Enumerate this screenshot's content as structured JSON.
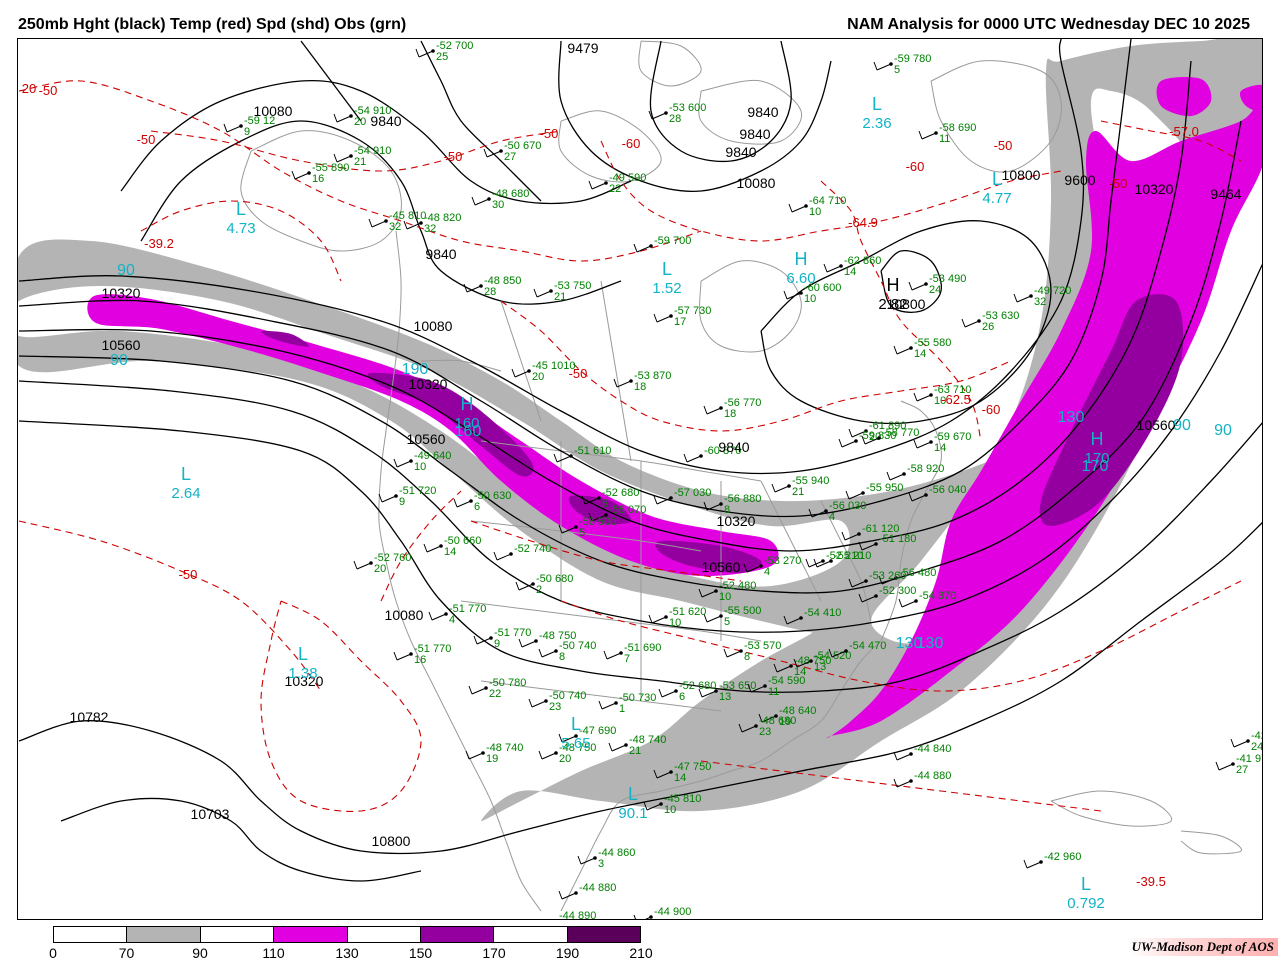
{
  "header": {
    "left_title": "250mb Hght (black) Temp (red) Spd (shd) Obs (grn)",
    "right_title": "NAM Analysis for 0000 UTC Wednesday  DEC 10 2025"
  },
  "legend": {
    "labels": [
      "0",
      "70",
      "90",
      "110",
      "130",
      "150",
      "170",
      "190",
      "210"
    ],
    "colors": [
      "#ffffff",
      "#b4b4b4",
      "#ffffff",
      "#e000e0",
      "#ffffff",
      "#9400a0",
      "#ffffff",
      "#5a005a"
    ]
  },
  "credit": "UW-Madison  Dept of AOS",
  "colors": {
    "height": "#000000",
    "temperature": "#cc0000",
    "observations": "#008000",
    "speed_label": "#11b3c4",
    "map_lines": "#9a9a9a"
  },
  "height_labels": [
    {
      "text": "10080"
    },
    {
      "text": "9840"
    },
    {
      "text": "9840"
    },
    {
      "text": "9840"
    },
    {
      "text": "9840"
    },
    {
      "text": "9479"
    },
    {
      "text": "10320"
    },
    {
      "text": "10560"
    },
    {
      "text": "10080"
    },
    {
      "text": "10320"
    },
    {
      "text": "10560"
    },
    {
      "text": "9840"
    },
    {
      "text": "10080"
    },
    {
      "text": "10320"
    },
    {
      "text": "10560"
    },
    {
      "text": "10080"
    },
    {
      "text": "10320"
    },
    {
      "text": "10782"
    },
    {
      "text": "10703"
    },
    {
      "text": "10800"
    },
    {
      "text": "10800"
    },
    {
      "text": "10800"
    },
    {
      "text": "9464"
    },
    {
      "text": "9600"
    },
    {
      "text": "10560"
    },
    {
      "text": "9840"
    },
    {
      "text": "10320"
    }
  ],
  "temp_labels": [
    {
      "text": "-50"
    },
    {
      "text": "-50"
    },
    {
      "text": "-50"
    },
    {
      "text": "-50"
    },
    {
      "text": "-50"
    },
    {
      "text": "-50"
    },
    {
      "text": "-60"
    },
    {
      "text": "-60"
    },
    {
      "text": "-60"
    },
    {
      "text": "-50"
    },
    {
      "text": "-50"
    },
    {
      "text": "-57.0"
    },
    {
      "text": "-64.9"
    },
    {
      "text": "-62.5"
    },
    {
      "text": "-39.2"
    },
    {
      "text": "-39.5"
    },
    {
      "text": "20"
    }
  ],
  "speed_labels": [
    {
      "text": "90"
    },
    {
      "text": "90"
    },
    {
      "text": "90"
    },
    {
      "text": "90"
    },
    {
      "text": "130"
    },
    {
      "text": "130"
    },
    {
      "text": "190"
    },
    {
      "text": "170"
    },
    {
      "text": "160"
    },
    {
      "text": "130"
    }
  ],
  "pressure_centers": [
    {
      "letter": "L",
      "value": "4.73"
    },
    {
      "letter": "L",
      "value": "2.64"
    },
    {
      "letter": "L",
      "value": "1.38"
    },
    {
      "letter": "L",
      "value": "2.36"
    },
    {
      "letter": "L",
      "value": "4.77"
    },
    {
      "letter": "L",
      "value": "1.52"
    },
    {
      "letter": "H",
      "value": "2.82"
    },
    {
      "letter": "H",
      "value": "170"
    },
    {
      "letter": "H",
      "value": "160"
    },
    {
      "letter": "L",
      "value": "0.792"
    },
    {
      "letter": "L",
      "value": "90.1"
    },
    {
      "letter": "L",
      "value": "5.65"
    },
    {
      "letter": "H",
      "value": "6.60"
    }
  ],
  "observations": [
    {
      "t": "-52",
      "h": "700",
      "d": "25"
    },
    {
      "t": "-54",
      "h": "910",
      "d": "20"
    },
    {
      "t": "-59",
      "h": "12",
      "d": "9"
    },
    {
      "t": "-55",
      "h": "890",
      "d": "16"
    },
    {
      "t": "-54",
      "h": "910",
      "d": "21"
    },
    {
      "t": "-50",
      "h": "670",
      "d": "27"
    },
    {
      "t": "-48",
      "h": "680",
      "d": "30"
    },
    {
      "t": "-49",
      "h": "590",
      "d": "22"
    },
    {
      "t": "-53",
      "h": "600",
      "d": "28"
    },
    {
      "t": "-59",
      "h": "700",
      "d": ""
    },
    {
      "t": "-45",
      "h": "810",
      "d": "32"
    },
    {
      "t": "-48",
      "h": "820",
      "d": "32"
    },
    {
      "t": "-48",
      "h": "850",
      "d": "28"
    },
    {
      "t": "-53",
      "h": "750",
      "d": "21"
    },
    {
      "t": "-57",
      "h": "730",
      "d": "17"
    },
    {
      "t": "-60",
      "h": "600",
      "d": "10"
    },
    {
      "t": "-64",
      "h": "710",
      "d": "10"
    },
    {
      "t": "-62",
      "h": "860",
      "d": "14"
    },
    {
      "t": "-53",
      "h": "490",
      "d": "24"
    },
    {
      "t": "-59",
      "h": "780",
      "d": "5"
    },
    {
      "t": "-58",
      "h": "690",
      "d": "11"
    },
    {
      "t": "-49",
      "h": "720",
      "d": "32"
    },
    {
      "t": "-53",
      "h": "630",
      "d": "26"
    },
    {
      "t": "-55",
      "h": "580",
      "d": "14"
    },
    {
      "t": "-63",
      "h": "710",
      "d": "10"
    },
    {
      "t": "-59",
      "h": "670",
      "d": "14"
    },
    {
      "t": "-56",
      "h": "770",
      "d": "18"
    },
    {
      "t": "-53",
      "h": "870",
      "d": "18"
    },
    {
      "t": "-61",
      "h": "890",
      "d": "20"
    },
    {
      "t": "-52",
      "h": "680",
      "d": "5"
    },
    {
      "t": "-45",
      "h": "1010",
      "d": "20"
    },
    {
      "t": "-49",
      "h": "640",
      "d": "10"
    },
    {
      "t": "-51",
      "h": "720",
      "d": "9"
    },
    {
      "t": "-50",
      "h": "630",
      "d": "6"
    },
    {
      "t": "-50",
      "h": "660",
      "d": "14"
    },
    {
      "t": "-52",
      "h": "760",
      "d": "20"
    },
    {
      "t": "-50",
      "h": "680",
      "d": "2"
    },
    {
      "t": "-51",
      "h": "770",
      "d": "4"
    },
    {
      "t": "-51",
      "h": "770",
      "d": "9"
    },
    {
      "t": "-51",
      "h": "770",
      "d": "16"
    },
    {
      "t": "-50",
      "h": "740",
      "d": "8"
    },
    {
      "t": "-50",
      "h": "780",
      "d": "22"
    },
    {
      "t": "-50",
      "h": "740",
      "d": "23"
    },
    {
      "t": "-51",
      "h": "690",
      "d": "7"
    },
    {
      "t": "-50",
      "h": "730",
      "d": "1"
    },
    {
      "t": "-52",
      "h": "680",
      "d": "6"
    },
    {
      "t": "-53",
      "h": "650",
      "d": "13"
    },
    {
      "t": "-53",
      "h": "570",
      "d": "8"
    },
    {
      "t": "-54",
      "h": "590",
      "d": "11"
    },
    {
      "t": "-48",
      "h": "740",
      "d": "19"
    },
    {
      "t": "-48",
      "h": "750",
      "d": "20"
    },
    {
      "t": "-48",
      "h": "740",
      "d": "21"
    },
    {
      "t": "-47",
      "h": "750",
      "d": "14"
    },
    {
      "t": "-45",
      "h": "810",
      "d": "10"
    },
    {
      "t": "-44",
      "h": "860",
      "d": "3"
    },
    {
      "t": "-44",
      "h": "880",
      "d": ""
    },
    {
      "t": "-44",
      "h": "890",
      "d": ""
    },
    {
      "t": "-44",
      "h": "900",
      "d": ""
    },
    {
      "t": "-44",
      "h": "840",
      "d": ""
    },
    {
      "t": "-44",
      "h": "880",
      "d": ""
    },
    {
      "t": "-42",
      "h": "960",
      "d": ""
    },
    {
      "t": "-42",
      "h": "",
      "d": "24"
    },
    {
      "t": "-41",
      "h": "970",
      "d": "27"
    },
    {
      "t": "-48",
      "h": "750",
      "d": "14"
    },
    {
      "t": "-48",
      "h": "640",
      "d": "19"
    },
    {
      "t": "-48",
      "h": "680",
      "d": "23"
    },
    {
      "t": "-54",
      "h": "520",
      "d": "13"
    },
    {
      "t": "-54",
      "h": "470",
      "d": ""
    },
    {
      "t": "-54",
      "h": "410",
      "d": ""
    },
    {
      "t": "-55",
      "h": "500",
      "d": "5"
    },
    {
      "t": "-51",
      "h": "620",
      "d": "10"
    },
    {
      "t": "-52",
      "h": "480",
      "d": "10"
    },
    {
      "t": "-56",
      "h": "480",
      "d": ""
    },
    {
      "t": "-53",
      "h": "260",
      "d": ""
    },
    {
      "t": "-52",
      "h": "300",
      "d": ""
    },
    {
      "t": "-54",
      "h": "370",
      "d": ""
    },
    {
      "t": "-51",
      "h": "180",
      "d": ""
    },
    {
      "t": "-61",
      "h": "120",
      "d": ""
    },
    {
      "t": "-52",
      "h": "210",
      "d": ""
    },
    {
      "t": "-53",
      "h": "270",
      "d": "4"
    },
    {
      "t": "-55",
      "h": "210",
      "d": ""
    },
    {
      "t": "-56",
      "h": "030",
      "d": "4"
    },
    {
      "t": "-55",
      "h": "940",
      "d": "21"
    },
    {
      "t": "-55",
      "h": "950",
      "d": ""
    },
    {
      "t": "-56",
      "h": "040",
      "d": ""
    },
    {
      "t": "-58",
      "h": "920",
      "d": ""
    },
    {
      "t": "-59",
      "h": "830",
      "d": ""
    },
    {
      "t": "-58",
      "h": "770",
      "d": ""
    },
    {
      "t": "-60",
      "h": "870",
      "d": ""
    },
    {
      "t": "-56",
      "h": "880",
      "d": "8"
    },
    {
      "t": "-57",
      "h": "030",
      "d": ""
    },
    {
      "t": "-58",
      "h": "070",
      "d": ""
    },
    {
      "t": "-56",
      "h": "500",
      "d": "5"
    },
    {
      "t": "-51",
      "h": "610",
      "d": ""
    },
    {
      "t": "-52",
      "h": "740",
      "d": ""
    },
    {
      "t": "-47",
      "h": "690",
      "d": ""
    },
    {
      "t": "-48",
      "h": "750",
      "d": ""
    },
    {
      "t": "-52",
      "h": "680",
      "d": ""
    }
  ]
}
